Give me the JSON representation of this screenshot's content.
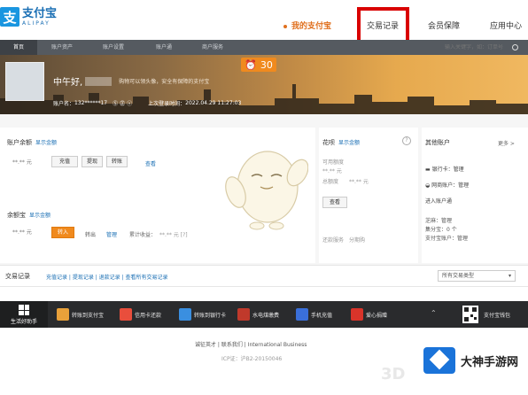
{
  "header": {
    "logo_mark": "支",
    "logo_cn": "支付宝",
    "logo_en": "ALIPAY",
    "nav": [
      "我的支付宝",
      "交易记录",
      "会员保障",
      "应用中心"
    ]
  },
  "subnav": {
    "items": [
      "首页",
      "账户资产",
      "账户设置",
      "账户通",
      "商户服务"
    ],
    "search_placeholder": "输入关键字，如：订单号"
  },
  "banner": {
    "greeting": "中午好,",
    "greeting_sub": "购物可以领头像，安全有保障的支付宝",
    "account_label": "账户名：",
    "account_value": "132******17",
    "account_icons": "Ⓢ㊣ⓥ",
    "last_login_label": "上次登录时间：",
    "last_login_value": "2022.04.29 11:27:03",
    "timer_value": "30"
  },
  "balance": {
    "title": "账户余额",
    "show_amount": "显示金额",
    "amount": "**.** 元",
    "buttons": [
      "充值",
      "提现",
      "转账"
    ],
    "view_link": "查看"
  },
  "yuebao": {
    "title": "余额宝",
    "show_amount": "显示金额",
    "amount": "**.** 元",
    "buy_button": "转入",
    "links": [
      "转出",
      "管理"
    ],
    "earnings_label": "累计收益：",
    "earnings_value": "**.** 元 [?]"
  },
  "huabei": {
    "title": "花呗",
    "show_amount": "显示金额",
    "line1": "可用额度",
    "line2": "**.** 元",
    "line3": "总额度",
    "line4": "**.** 元",
    "button": "查看",
    "bottom_left": "还款服务",
    "bottom_right": "分期购"
  },
  "other_accounts": {
    "title": "其他账户",
    "more": "更多 >",
    "items": [
      "银行卡：管理",
      "网商账户：管理",
      "进入账户通",
      "芝麻：管理",
      "集分宝：0 个",
      "支付宝账户：管理"
    ]
  },
  "trade": {
    "title": "交易记录",
    "links": "充值记录 | 提现记录 | 退款记录 | 查看所有交易记录",
    "select_value": "所有交易类型"
  },
  "bottom_bar": {
    "home_label": "生活好助手",
    "items": [
      "转账到支付宝",
      "信用卡还款",
      "转账到银行卡",
      "水电煤缴费",
      "手机充值",
      "爱心捐赠"
    ],
    "qr_label": "支付宝钱包"
  },
  "footer": {
    "links": "诚征英才 | 联系我们 | International Business",
    "icp": "ICP证：沪B2-20150046"
  },
  "watermark": {
    "text_3d": "3D",
    "brand": "大神手游网"
  }
}
